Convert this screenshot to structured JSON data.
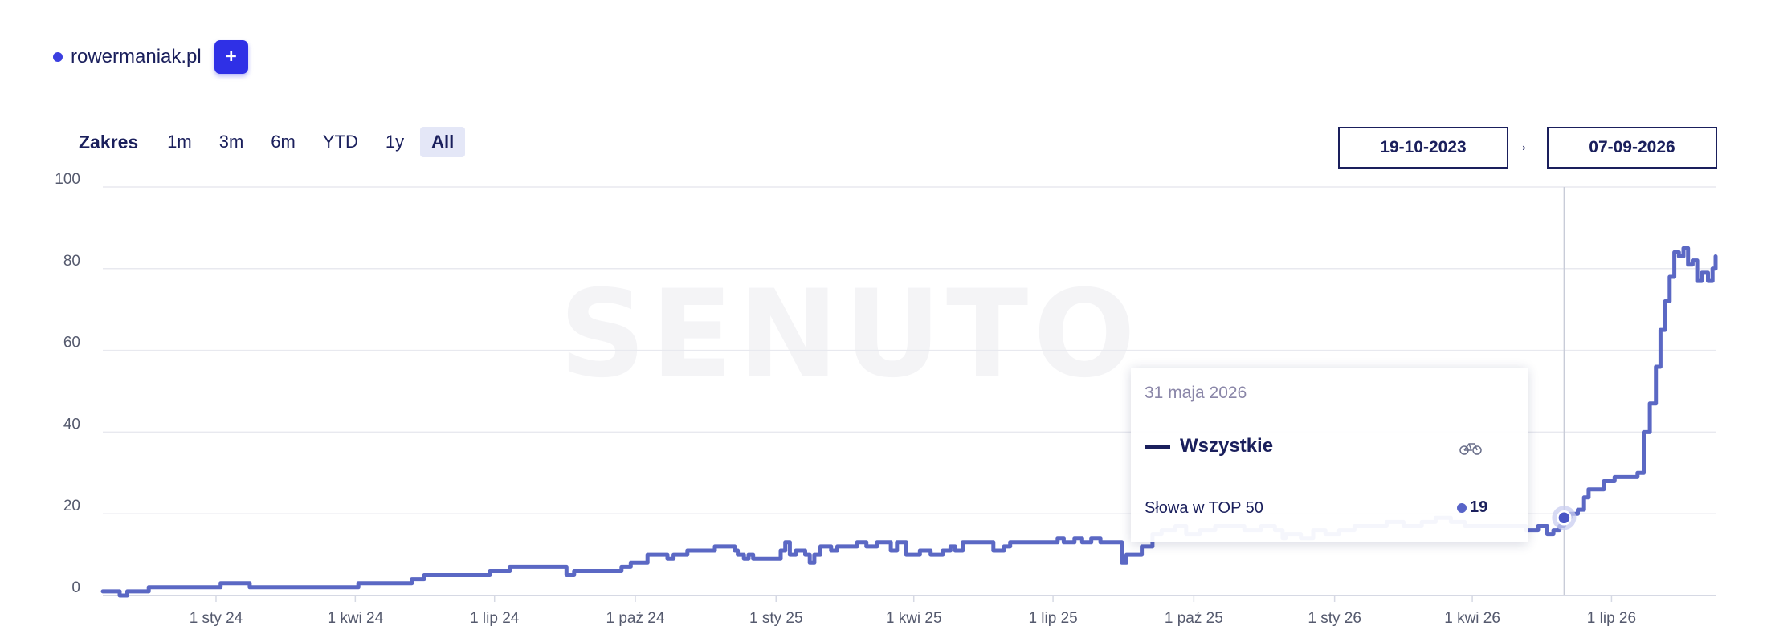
{
  "legend": {
    "label": "rowermaniak.pl",
    "add_label": "+",
    "color": "#3b3fe0"
  },
  "range": {
    "title": "Zakres",
    "buttons": [
      {
        "label": "1m",
        "active": false
      },
      {
        "label": "3m",
        "active": false
      },
      {
        "label": "6m",
        "active": false
      },
      {
        "label": "YTD",
        "active": false
      },
      {
        "label": "1y",
        "active": false
      },
      {
        "label": "All",
        "active": true
      }
    ]
  },
  "dates": {
    "from": "19-10-2023",
    "arrow": "→",
    "to": "07-09-2026"
  },
  "watermark": "SENUTO",
  "tooltip": {
    "date": "31 maja 2026",
    "series_name": "Wszystkie",
    "metric_label": "Słowa w TOP 50",
    "metric_value": "19"
  },
  "colors": {
    "series": "#5b68c4",
    "accent": "#2f30e6",
    "text": "#1a1f5c"
  },
  "chart_data": {
    "type": "line",
    "ylim": [
      0,
      100
    ],
    "yticks": [
      "0",
      "20",
      "40",
      "60",
      "80",
      "100"
    ],
    "xlim": [
      "2023-10-19",
      "2026-09-07"
    ],
    "xticks": [
      {
        "date": "2024-01-01",
        "label": "1 sty 24"
      },
      {
        "date": "2024-04-01",
        "label": "1 kwi 24"
      },
      {
        "date": "2024-07-01",
        "label": "1 lip 24"
      },
      {
        "date": "2024-10-01",
        "label": "1 paź 24"
      },
      {
        "date": "2025-01-01",
        "label": "1 sty 25"
      },
      {
        "date": "2025-04-01",
        "label": "1 kwi 25"
      },
      {
        "date": "2025-07-01",
        "label": "1 lip 25"
      },
      {
        "date": "2025-10-01",
        "label": "1 paź 25"
      },
      {
        "date": "2026-01-01",
        "label": "1 sty 26"
      },
      {
        "date": "2026-04-01",
        "label": "1 kwi 26"
      },
      {
        "date": "2026-07-01",
        "label": "1 lip 26"
      }
    ],
    "highlight": {
      "date": "2026-05-31",
      "value": 19
    },
    "series": [
      {
        "name": "Wszystkie",
        "color": "#5b68c4",
        "points": [
          [
            "2023-10-19",
            1
          ],
          [
            "2023-10-26",
            1
          ],
          [
            "2023-10-30",
            0
          ],
          [
            "2023-11-04",
            1
          ],
          [
            "2023-11-15",
            1
          ],
          [
            "2023-11-18",
            2
          ],
          [
            "2024-01-01",
            2
          ],
          [
            "2024-01-04",
            3
          ],
          [
            "2024-01-20",
            3
          ],
          [
            "2024-01-23",
            2
          ],
          [
            "2024-04-01",
            2
          ],
          [
            "2024-04-03",
            3
          ],
          [
            "2024-05-05",
            3
          ],
          [
            "2024-05-08",
            4
          ],
          [
            "2024-05-13",
            4
          ],
          [
            "2024-05-16",
            5
          ],
          [
            "2024-06-25",
            5
          ],
          [
            "2024-06-28",
            6
          ],
          [
            "2024-07-08",
            6
          ],
          [
            "2024-07-11",
            7
          ],
          [
            "2024-08-14",
            7
          ],
          [
            "2024-08-17",
            5
          ],
          [
            "2024-08-22",
            6
          ],
          [
            "2024-09-20",
            6
          ],
          [
            "2024-09-22",
            7
          ],
          [
            "2024-09-28",
            8
          ],
          [
            "2024-10-06",
            8
          ],
          [
            "2024-10-09",
            10
          ],
          [
            "2024-10-20",
            10
          ],
          [
            "2024-10-22",
            9
          ],
          [
            "2024-10-26",
            10
          ],
          [
            "2024-11-01",
            10
          ],
          [
            "2024-11-04",
            11
          ],
          [
            "2024-11-18",
            11
          ],
          [
            "2024-11-22",
            12
          ],
          [
            "2024-12-02",
            12
          ],
          [
            "2024-12-05",
            11
          ],
          [
            "2024-12-07",
            10
          ],
          [
            "2024-12-11",
            9
          ],
          [
            "2024-12-14",
            10
          ],
          [
            "2024-12-17",
            9
          ],
          [
            "2024-12-30",
            9
          ],
          [
            "2025-01-04",
            11
          ],
          [
            "2025-01-07",
            13
          ],
          [
            "2025-01-10",
            10
          ],
          [
            "2025-01-14",
            11
          ],
          [
            "2025-01-20",
            10
          ],
          [
            "2025-01-23",
            8
          ],
          [
            "2025-01-26",
            10
          ],
          [
            "2025-01-30",
            12
          ],
          [
            "2025-02-06",
            11
          ],
          [
            "2025-02-10",
            12
          ],
          [
            "2025-02-20",
            12
          ],
          [
            "2025-02-23",
            13
          ],
          [
            "2025-03-01",
            12
          ],
          [
            "2025-03-08",
            13
          ],
          [
            "2025-03-17",
            11
          ],
          [
            "2025-03-21",
            13
          ],
          [
            "2025-03-27",
            10
          ],
          [
            "2025-04-05",
            11
          ],
          [
            "2025-04-12",
            10
          ],
          [
            "2025-04-20",
            11
          ],
          [
            "2025-04-25",
            12
          ],
          [
            "2025-04-28",
            11
          ],
          [
            "2025-05-03",
            13
          ],
          [
            "2025-05-20",
            13
          ],
          [
            "2025-05-23",
            11
          ],
          [
            "2025-05-30",
            12
          ],
          [
            "2025-06-03",
            13
          ],
          [
            "2025-07-01",
            13
          ],
          [
            "2025-07-04",
            14
          ],
          [
            "2025-07-08",
            13
          ],
          [
            "2025-07-15",
            14
          ],
          [
            "2025-07-20",
            13
          ],
          [
            "2025-07-26",
            14
          ],
          [
            "2025-08-01",
            13
          ],
          [
            "2025-08-11",
            13
          ],
          [
            "2025-08-15",
            8
          ],
          [
            "2025-08-18",
            10
          ],
          [
            "2025-08-24",
            10
          ],
          [
            "2025-08-28",
            12
          ],
          [
            "2025-09-04",
            15
          ],
          [
            "2025-09-10",
            16
          ],
          [
            "2025-09-19",
            17
          ],
          [
            "2025-09-22",
            17
          ],
          [
            "2025-09-26",
            15
          ],
          [
            "2025-10-05",
            16
          ],
          [
            "2025-10-15",
            17
          ],
          [
            "2025-10-25",
            17
          ],
          [
            "2025-11-03",
            16
          ],
          [
            "2025-11-14",
            17
          ],
          [
            "2025-11-23",
            16
          ],
          [
            "2025-11-28",
            14
          ],
          [
            "2025-11-30",
            15
          ],
          [
            "2025-12-10",
            14
          ],
          [
            "2025-12-18",
            16
          ],
          [
            "2025-12-26",
            15
          ],
          [
            "2026-01-04",
            16
          ],
          [
            "2026-01-14",
            17
          ],
          [
            "2026-01-26",
            17
          ],
          [
            "2026-02-04",
            18
          ],
          [
            "2026-02-15",
            17
          ],
          [
            "2026-02-27",
            18
          ],
          [
            "2026-03-08",
            19
          ],
          [
            "2026-03-18",
            18
          ],
          [
            "2026-03-27",
            17
          ],
          [
            "2026-04-06",
            17
          ],
          [
            "2026-04-16",
            17
          ],
          [
            "2026-04-26",
            17
          ],
          [
            "2026-05-06",
            16
          ],
          [
            "2026-05-14",
            17
          ],
          [
            "2026-05-20",
            15
          ],
          [
            "2026-05-24",
            16
          ],
          [
            "2026-05-28",
            17
          ],
          [
            "2026-05-31",
            19
          ],
          [
            "2026-06-04",
            20
          ],
          [
            "2026-06-09",
            21
          ],
          [
            "2026-06-13",
            24
          ],
          [
            "2026-06-16",
            26
          ],
          [
            "2026-06-22",
            26
          ],
          [
            "2026-06-26",
            28
          ],
          [
            "2026-07-03",
            29
          ],
          [
            "2026-07-14",
            29
          ],
          [
            "2026-07-18",
            30
          ],
          [
            "2026-07-22",
            40
          ],
          [
            "2026-07-26",
            47
          ],
          [
            "2026-07-30",
            56
          ],
          [
            "2026-08-02",
            65
          ],
          [
            "2026-08-05",
            72
          ],
          [
            "2026-08-08",
            78
          ],
          [
            "2026-08-11",
            84
          ],
          [
            "2026-08-14",
            83
          ],
          [
            "2026-08-17",
            85
          ],
          [
            "2026-08-20",
            81
          ],
          [
            "2026-08-23",
            82
          ],
          [
            "2026-08-26",
            77
          ],
          [
            "2026-08-29",
            79
          ],
          [
            "2026-09-02",
            77
          ],
          [
            "2026-09-05",
            80
          ],
          [
            "2026-09-07",
            83
          ]
        ]
      }
    ]
  }
}
